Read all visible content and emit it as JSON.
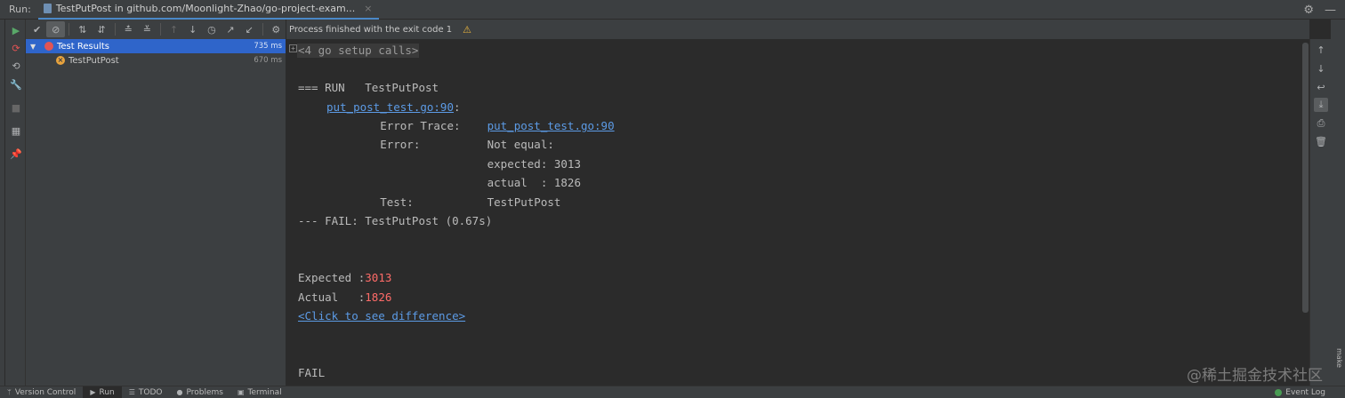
{
  "topbar": {
    "run_label": "Run:",
    "tab_title": "TestPutPost in github.com/Moonlight-Zhao/go-project-exam...",
    "tab_close": "×",
    "settings_icon": "⚙",
    "minimize_icon": "—"
  },
  "toolbar": {
    "icons": [
      "sort-alpha-icon",
      "sort-duration-icon",
      "expand-all-icon",
      "collapse-all-icon",
      "previous-failed-icon",
      "next-failed-icon",
      "history-icon",
      "export-icon",
      "import-icon",
      "settings-icon"
    ]
  },
  "tree": {
    "root_label": "Test Results",
    "root_time": "735 ms",
    "child_label": "TestPutPost",
    "child_time": "670 ms"
  },
  "console": {
    "status": "Process finished with the exit code 1",
    "collapsed": "<4 go setup calls>",
    "run_line": "=== RUN   TestPutPost",
    "file_link": "put_post_test.go:90",
    "file_colon": ":",
    "error_trace_label": "        Error Trace:    ",
    "error_trace_link": "put_post_test.go:90",
    "error_line": "        Error:          Not equal:",
    "expected_line": "                        expected: 3013",
    "actual_line": "                        actual  : 1826",
    "test_line": "        Test:           TestPutPost",
    "fail_line": "--- FAIL: TestPutPost (0.67s)",
    "expected_label": "Expected :",
    "expected_value": "3013",
    "actual_label": "Actual   :",
    "actual_value": "1826",
    "diff_link": "<Click to see difference>",
    "final": "FAIL"
  },
  "right_strip": {
    "make_label": "make"
  },
  "bottombar": {
    "version_control": "Version Control",
    "run": "Run",
    "todo": "TODO",
    "problems": "Problems",
    "terminal": "Terminal",
    "event_log": "Event Log"
  },
  "watermark": "@稀土掘金技术社区",
  "colors": {
    "accent": "#2f65ca",
    "link": "#5c9be6",
    "error_value": "#ff6b68",
    "warning": "#e8b33d"
  }
}
